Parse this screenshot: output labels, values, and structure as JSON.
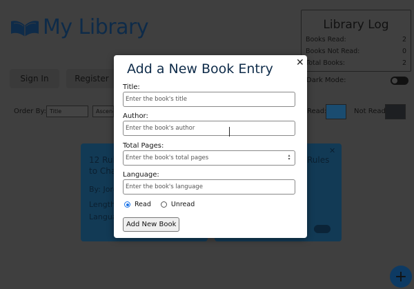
{
  "app": {
    "title": "My Library"
  },
  "log": {
    "title": "Library Log",
    "rows": [
      {
        "label": "Books Read:",
        "value": "2"
      },
      {
        "label": "Books Not Read:",
        "value": "0"
      },
      {
        "label": "Total Books:",
        "value": "2"
      }
    ]
  },
  "auth": {
    "sign_in": "Sign In",
    "register": "Register"
  },
  "dark_mode": {
    "label": "Dark Mode:"
  },
  "order": {
    "label": "Order By:",
    "field": "Title",
    "direction": "Ascend"
  },
  "legend": {
    "read": "Read:",
    "not_read": "Not Read:",
    "read_color": "#1a4c70",
    "not_read_color": "#1d1f22"
  },
  "cards": [
    {
      "title_fragment": "12 Rul",
      "title_line2": "to Cha",
      "author_fragment": "By: Jord",
      "length_fragment": "Length",
      "language_fragment": "Langua"
    },
    {
      "title_fragment": "Rules",
      "close_icon": "close-icon"
    }
  ],
  "modal": {
    "title": "Add a New Book Entry",
    "fields": {
      "title": {
        "label": "Title:",
        "placeholder": "Enter the book's title",
        "value": ""
      },
      "author": {
        "label": "Author:",
        "placeholder": "Enter the book's author",
        "value": ""
      },
      "pages": {
        "label": "Total Pages:",
        "placeholder": "Enter the book's total pages",
        "value": ""
      },
      "language": {
        "label": "Language:",
        "placeholder": "Enter the book's language",
        "value": ""
      }
    },
    "status": {
      "read": "Read",
      "unread": "Unread",
      "selected": "Read"
    },
    "submit": "Add New Book"
  },
  "fab": {
    "symbol": "+"
  }
}
